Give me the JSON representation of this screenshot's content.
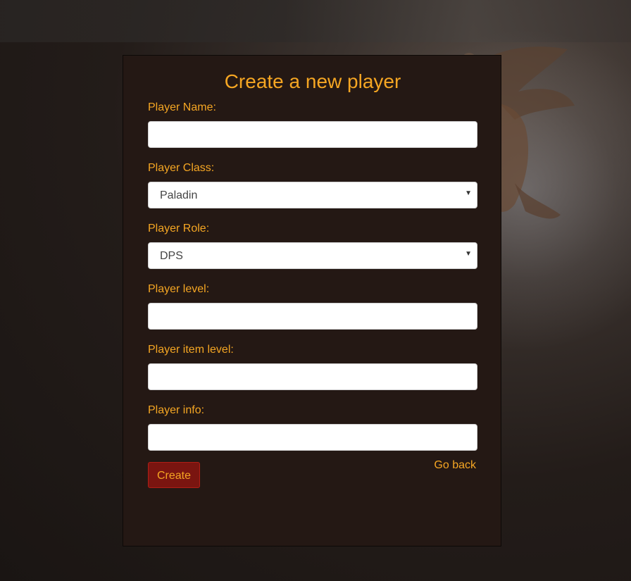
{
  "page": {
    "title": "Create a new player"
  },
  "form": {
    "name_label": "Player Name:",
    "name_value": "",
    "class_label": "Player Class:",
    "class_selected": "Paladin",
    "role_label": "Player Role:",
    "role_selected": "DPS",
    "level_label": "Player level:",
    "level_value": "",
    "item_level_label": "Player item level:",
    "item_level_value": "",
    "info_label": "Player info:",
    "info_value": ""
  },
  "actions": {
    "create_label": "Create",
    "go_back_label": "Go back"
  },
  "icons": {
    "select_arrow": "chevron-down-icon"
  },
  "colors": {
    "accent": "#f5a623",
    "panel_bg": "#241814",
    "button_bg": "#7a1510",
    "button_border": "#b01e16"
  }
}
